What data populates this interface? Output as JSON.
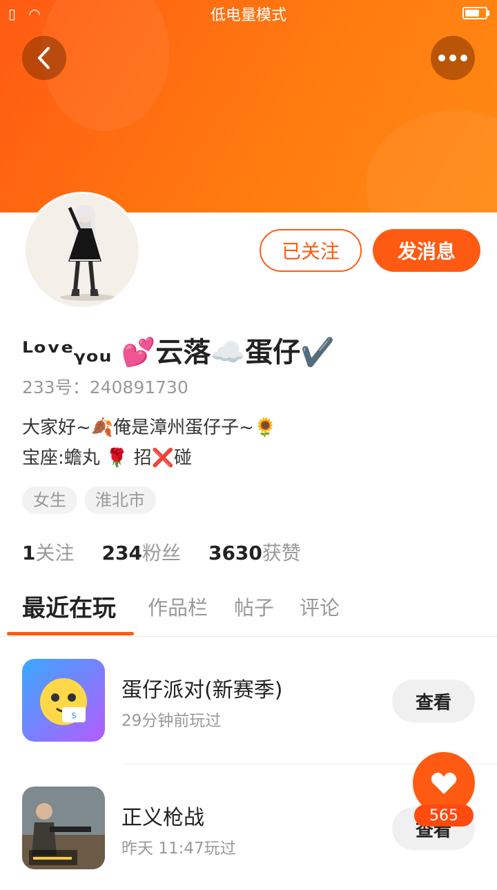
{
  "status_bar": {
    "mode_label": "低电量模式",
    "battery_level": 0.7
  },
  "profile": {
    "nickname": "ᴸᵒᵛᵉᵧₒᵤ 💕云落☁️蛋仔✔️",
    "uid_label": "233号：240891730",
    "bio_lines": [
      "大家好~🍂俺是漳州蛋仔子~🌻",
      "宝座:蟾丸 🌹 招❌碰"
    ],
    "tags": [
      "女生",
      "淮北市"
    ],
    "stats": [
      {
        "value": "1",
        "label": "关注"
      },
      {
        "value": "234",
        "label": "粉丝"
      },
      {
        "value": "3630",
        "label": "获赞"
      }
    ]
  },
  "actions": {
    "follow_label": "已关注",
    "message_label": "发消息"
  },
  "tabs": [
    {
      "label": "最近在玩",
      "active": true
    },
    {
      "label": "作品栏",
      "active": false
    },
    {
      "label": "帖子",
      "active": false
    },
    {
      "label": "评论",
      "active": false
    }
  ],
  "games": [
    {
      "name": "蛋仔派对(新赛季)",
      "time": "29分钟前玩过",
      "button": "查看"
    },
    {
      "name": "正义枪战",
      "time": "昨天 11:47玩过",
      "button": "查看"
    }
  ],
  "like": {
    "count": "565"
  },
  "icons": {
    "back": "chevron-left-icon",
    "more": "more-icon",
    "like": "heart-icon",
    "signal": "sim-icon",
    "wifi": "wifi-icon",
    "battery": "battery-icon"
  },
  "colors": {
    "accent": "#ff5a12"
  }
}
